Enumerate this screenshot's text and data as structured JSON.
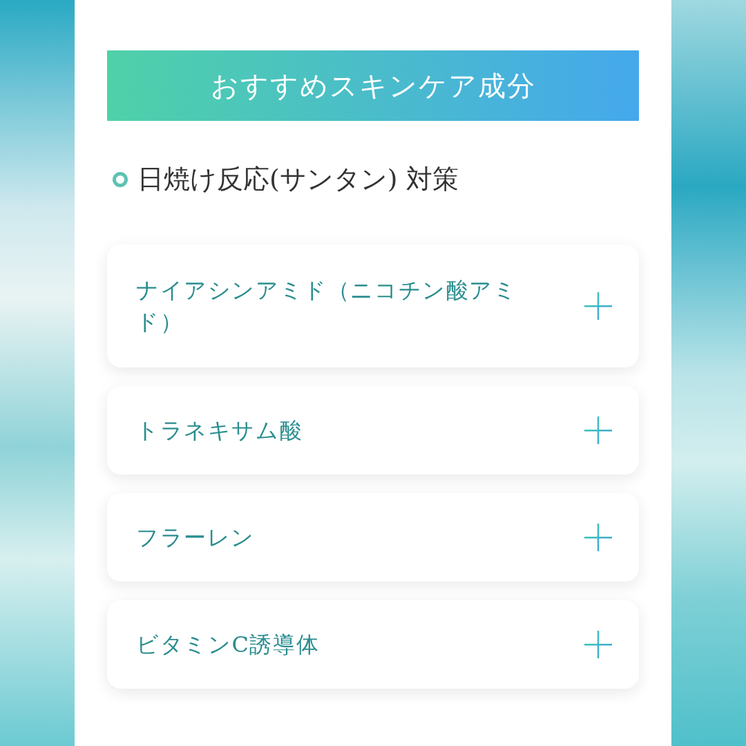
{
  "banner": {
    "title": "おすすめスキンケア成分"
  },
  "section": {
    "heading": "日焼け反応(サンタン) 対策"
  },
  "accordion": [
    {
      "label": "ナイアシンアミド（ニコチン酸アミド）",
      "expanded": false
    },
    {
      "label": "トラネキサム酸",
      "expanded": false
    },
    {
      "label": "フラーレン",
      "expanded": false
    },
    {
      "label": "ビタミンC誘導体",
      "expanded": false
    }
  ]
}
